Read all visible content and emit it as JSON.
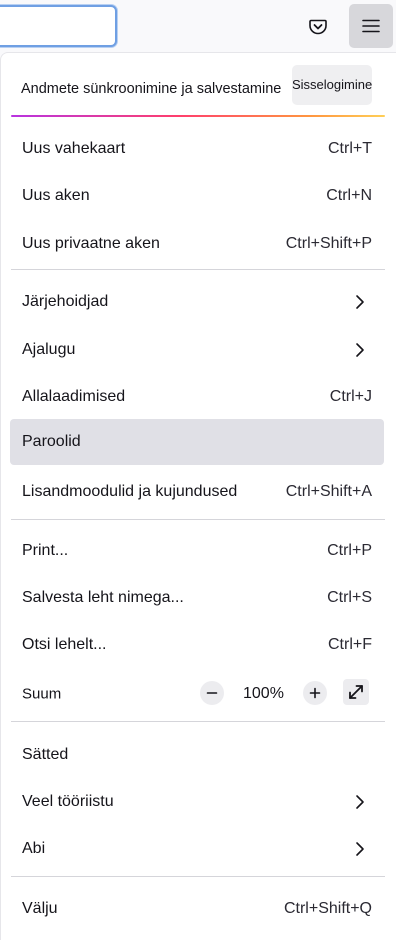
{
  "toolbar": {
    "pocket_icon": "pocket-icon",
    "menu_icon": "hamburger-menu-icon"
  },
  "sync": {
    "text": "Andmete sünkroonimine ja salvestamine",
    "signin_label": "Sisselogimine"
  },
  "menu": {
    "new_tab": {
      "label": "Uus vahekaart",
      "shortcut": "Ctrl+T"
    },
    "new_window": {
      "label": "Uus aken",
      "shortcut": "Ctrl+N"
    },
    "private_window": {
      "label": "Uus privaatne aken",
      "shortcut": "Ctrl+Shift+P"
    },
    "bookmarks": {
      "label": "Järjehoidjad"
    },
    "history": {
      "label": "Ajalugu"
    },
    "downloads": {
      "label": "Allalaadimised",
      "shortcut": "Ctrl+J"
    },
    "passwords": {
      "label": "Paroolid"
    },
    "addons": {
      "label": "Lisandmoodulid ja kujundused",
      "shortcut": "Ctrl+Shift+A"
    },
    "print": {
      "label": "Print...",
      "shortcut": "Ctrl+P"
    },
    "save_page": {
      "label": "Salvesta leht nimega...",
      "shortcut": "Ctrl+S"
    },
    "find": {
      "label": "Otsi lehelt...",
      "shortcut": "Ctrl+F"
    },
    "zoom": {
      "label": "Suum",
      "value": "100%"
    },
    "settings": {
      "label": "Sätted"
    },
    "more_tools": {
      "label": "Veel tööriistu"
    },
    "help": {
      "label": "Abi"
    },
    "exit": {
      "label": "Välju",
      "shortcut": "Ctrl+Shift+Q"
    }
  },
  "colors": {
    "accent_gradient": [
      "#b833e1",
      "#ff3f6c",
      "#ff9640",
      "#ffcf57"
    ],
    "hover_bg": "#e0e0e6",
    "urlbar_focus": "#6f9fe3"
  }
}
